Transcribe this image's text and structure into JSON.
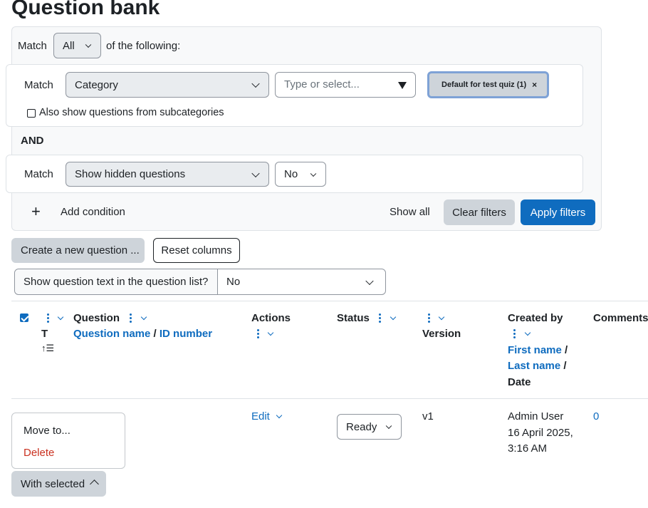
{
  "page": {
    "title": "Question bank"
  },
  "filters": {
    "match_label": "Match",
    "join_value": "All",
    "of_following": "of the following:",
    "condition1": {
      "match_label": "Match",
      "field": "Category",
      "input_placeholder": "Type or select...",
      "selected_tag": "Default for test quiz (1)",
      "tag_remove": "×",
      "subcategories_label": "Also show questions from subcategories",
      "subcategories_checked": false
    },
    "and_label": "AND",
    "condition2": {
      "match_label": "Match",
      "field": "Show hidden questions",
      "value": "No"
    },
    "add_condition_icon": "+",
    "add_condition": "Add condition",
    "show_all": "Show all",
    "clear_filters": "Clear filters",
    "apply_filters": "Apply filters"
  },
  "actions": {
    "create_question": "Create a new question ...",
    "reset_columns": "Reset columns",
    "show_text_label": "Show question text in the question list?",
    "show_text_value": "No"
  },
  "table": {
    "headers": {
      "type": "T",
      "question": "Question",
      "question_name": "Question name",
      "slash": "/",
      "id_number": "ID number",
      "actions": "Actions",
      "status": "Status",
      "version": "Version",
      "created_by": "Created by",
      "first_name": "First name",
      "last_name": "Last name",
      "date": "Date",
      "comments": "Comments"
    },
    "rows": [
      {
        "actions": "Edit",
        "status": "Ready",
        "version": "v1",
        "created_by": "Admin User",
        "created_date": "16 April 2025,",
        "created_time": "3:16 AM",
        "comments": "0"
      }
    ]
  },
  "bulk": {
    "menu_items": [
      "Move to...",
      "Delete"
    ],
    "with_selected": "With selected"
  },
  "colors": {
    "primary": "#0f6cbf",
    "danger": "#ca3120",
    "secondary": "#ced4da"
  },
  "icons": [
    "chevron-down-icon",
    "kebab-icon",
    "sort-ascending-icon",
    "close-icon",
    "plus-icon",
    "chevron-up-icon",
    "triangle-down-icon"
  ]
}
